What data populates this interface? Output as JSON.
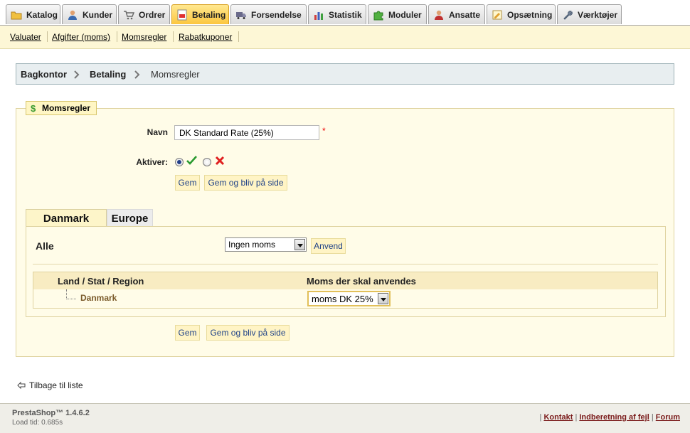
{
  "tabs": [
    {
      "label": "Katalog",
      "icon": "folder-icon"
    },
    {
      "label": "Kunder",
      "icon": "user-icon"
    },
    {
      "label": "Ordrer",
      "icon": "cart-icon"
    },
    {
      "label": "Betaling",
      "icon": "payment-icon",
      "active": true
    },
    {
      "label": "Forsendelse",
      "icon": "truck-icon"
    },
    {
      "label": "Statistik",
      "icon": "chart-icon"
    },
    {
      "label": "Moduler",
      "icon": "puzzle-icon"
    },
    {
      "label": "Ansatte",
      "icon": "employee-icon"
    },
    {
      "label": "Opsætning",
      "icon": "settings-icon"
    },
    {
      "label": "Værktøjer",
      "icon": "wrench-icon"
    }
  ],
  "subnav": [
    "Valuater",
    "Afgifter (moms)",
    "Momsregler",
    "Rabatkuponer"
  ],
  "breadcrumb": {
    "root": "Bagkontor",
    "section": "Betaling",
    "current": "Momsregler"
  },
  "form": {
    "legend": "Momsregler",
    "name_label": "Navn",
    "name_value": "DK Standard Rate (25%)",
    "required_mark": "*",
    "active_label": "Aktiver:",
    "active_value": "yes",
    "save_label": "Gem",
    "save_stay_label": "Gem og bliv på side"
  },
  "country_tabs": [
    "Danmark",
    "Europe"
  ],
  "panel": {
    "all_label": "Alle",
    "all_select_value": "Ingen moms",
    "apply_label": "Anvend",
    "col_region": "Land / Stat / Region",
    "col_tax": "Moms der skal anvendes",
    "rows": [
      {
        "country": "Danmark",
        "tax": "moms DK 25%"
      }
    ]
  },
  "back_link": "Tilbage til liste",
  "footer": {
    "version": "PrestaShop™ 1.4.6.2",
    "load_time": "Load tid: 0.685s",
    "links": [
      "Kontakt",
      "Indberetning af fejl",
      "Forum"
    ]
  },
  "colors": {
    "active_tab": "#fcc63e",
    "subnav_bg": "#fdf7d6",
    "button_bg": "#fff4c5",
    "footer_link": "#7a1a1a"
  }
}
